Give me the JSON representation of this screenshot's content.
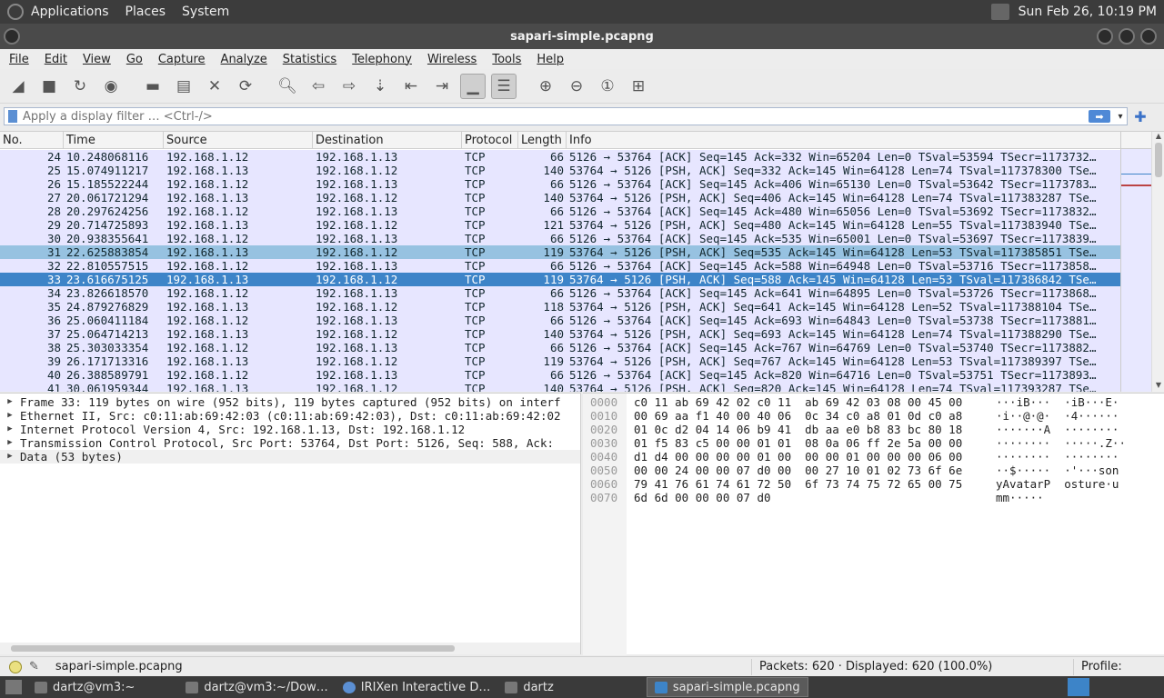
{
  "system_panel": {
    "menus": [
      "Applications",
      "Places",
      "System"
    ],
    "datetime": "Sun Feb 26, 10:19 PM"
  },
  "window": {
    "title": "sapari-simple.pcapng"
  },
  "menubar": [
    "File",
    "Edit",
    "View",
    "Go",
    "Capture",
    "Analyze",
    "Statistics",
    "Telephony",
    "Wireless",
    "Tools",
    "Help"
  ],
  "toolbar": {
    "icons": [
      "shark-fin-start-icon",
      "stop-icon",
      "restart-icon",
      "options-gear-icon",
      "open-folder-icon",
      "save-file-icon",
      "close-file-icon",
      "reload-icon",
      "search-icon",
      "go-back-icon",
      "go-forward-icon",
      "go-to-packet-icon",
      "first-packet-icon",
      "last-packet-icon",
      "autoscroll-icon",
      "colorize-icon",
      "zoom-in-icon",
      "zoom-out-icon",
      "zoom-normal-icon",
      "resize-columns-icon"
    ]
  },
  "filter": {
    "placeholder": "Apply a display filter … <Ctrl-/>"
  },
  "packet_list": {
    "columns": [
      "No.",
      "Time",
      "Source",
      "Destination",
      "Protocol",
      "Length",
      "Info"
    ],
    "rows": [
      {
        "no": "24",
        "time": "10.248068116",
        "src": "192.168.1.12",
        "dst": "192.168.1.13",
        "proto": "TCP",
        "len": "66",
        "info": "5126 → 53764 [ACK] Seq=145 Ack=332 Win=65204 Len=0 TSval=53594 TSecr=1173732…"
      },
      {
        "no": "25",
        "time": "15.074911217",
        "src": "192.168.1.13",
        "dst": "192.168.1.12",
        "proto": "TCP",
        "len": "140",
        "info": "53764 → 5126 [PSH, ACK] Seq=332 Ack=145 Win=64128 Len=74 TSval=117378300 TSe…"
      },
      {
        "no": "26",
        "time": "15.185522244",
        "src": "192.168.1.12",
        "dst": "192.168.1.13",
        "proto": "TCP",
        "len": "66",
        "info": "5126 → 53764 [ACK] Seq=145 Ack=406 Win=65130 Len=0 TSval=53642 TSecr=1173783…"
      },
      {
        "no": "27",
        "time": "20.061721294",
        "src": "192.168.1.13",
        "dst": "192.168.1.12",
        "proto": "TCP",
        "len": "140",
        "info": "53764 → 5126 [PSH, ACK] Seq=406 Ack=145 Win=64128 Len=74 TSval=117383287 TSe…"
      },
      {
        "no": "28",
        "time": "20.297624256",
        "src": "192.168.1.12",
        "dst": "192.168.1.13",
        "proto": "TCP",
        "len": "66",
        "info": "5126 → 53764 [ACK] Seq=145 Ack=480 Win=65056 Len=0 TSval=53692 TSecr=1173832…"
      },
      {
        "no": "29",
        "time": "20.714725893",
        "src": "192.168.1.13",
        "dst": "192.168.1.12",
        "proto": "TCP",
        "len": "121",
        "info": "53764 → 5126 [PSH, ACK] Seq=480 Ack=145 Win=64128 Len=55 TSval=117383940 TSe…"
      },
      {
        "no": "30",
        "time": "20.938355641",
        "src": "192.168.1.12",
        "dst": "192.168.1.13",
        "proto": "TCP",
        "len": "66",
        "info": "5126 → 53764 [ACK] Seq=145 Ack=535 Win=65001 Len=0 TSval=53697 TSecr=1173839…"
      },
      {
        "no": "31",
        "time": "22.625883854",
        "src": "192.168.1.13",
        "dst": "192.168.1.12",
        "proto": "TCP",
        "len": "119",
        "info": "53764 → 5126 [PSH, ACK] Seq=535 Ack=145 Win=64128 Len=53 TSval=117385851 TSe…",
        "state": "marked"
      },
      {
        "no": "32",
        "time": "22.810557515",
        "src": "192.168.1.12",
        "dst": "192.168.1.13",
        "proto": "TCP",
        "len": "66",
        "info": "5126 → 53764 [ACK] Seq=145 Ack=588 Win=64948 Len=0 TSval=53716 TSecr=1173858…"
      },
      {
        "no": "33",
        "time": "23.616675125",
        "src": "192.168.1.13",
        "dst": "192.168.1.12",
        "proto": "TCP",
        "len": "119",
        "info": "53764 → 5126 [PSH, ACK] Seq=588 Ack=145 Win=64128 Len=53 TSval=117386842 TSe…",
        "state": "selected"
      },
      {
        "no": "34",
        "time": "23.826618570",
        "src": "192.168.1.12",
        "dst": "192.168.1.13",
        "proto": "TCP",
        "len": "66",
        "info": "5126 → 53764 [ACK] Seq=145 Ack=641 Win=64895 Len=0 TSval=53726 TSecr=1173868…"
      },
      {
        "no": "35",
        "time": "24.879276829",
        "src": "192.168.1.13",
        "dst": "192.168.1.12",
        "proto": "TCP",
        "len": "118",
        "info": "53764 → 5126 [PSH, ACK] Seq=641 Ack=145 Win=64128 Len=52 TSval=117388104 TSe…"
      },
      {
        "no": "36",
        "time": "25.060411184",
        "src": "192.168.1.12",
        "dst": "192.168.1.13",
        "proto": "TCP",
        "len": "66",
        "info": "5126 → 53764 [ACK] Seq=145 Ack=693 Win=64843 Len=0 TSval=53738 TSecr=1173881…"
      },
      {
        "no": "37",
        "time": "25.064714213",
        "src": "192.168.1.13",
        "dst": "192.168.1.12",
        "proto": "TCP",
        "len": "140",
        "info": "53764 → 5126 [PSH, ACK] Seq=693 Ack=145 Win=64128 Len=74 TSval=117388290 TSe…"
      },
      {
        "no": "38",
        "time": "25.303033354",
        "src": "192.168.1.12",
        "dst": "192.168.1.13",
        "proto": "TCP",
        "len": "66",
        "info": "5126 → 53764 [ACK] Seq=145 Ack=767 Win=64769 Len=0 TSval=53740 TSecr=1173882…"
      },
      {
        "no": "39",
        "time": "26.171713316",
        "src": "192.168.1.13",
        "dst": "192.168.1.12",
        "proto": "TCP",
        "len": "119",
        "info": "53764 → 5126 [PSH, ACK] Seq=767 Ack=145 Win=64128 Len=53 TSval=117389397 TSe…"
      },
      {
        "no": "40",
        "time": "26.388589791",
        "src": "192.168.1.12",
        "dst": "192.168.1.13",
        "proto": "TCP",
        "len": "66",
        "info": "5126 → 53764 [ACK] Seq=145 Ack=820 Win=64716 Len=0 TSval=53751 TSecr=1173893…"
      },
      {
        "no": "41",
        "time": "30.061959344",
        "src": "192.168.1.13",
        "dst": "192.168.1.12",
        "proto": "TCP",
        "len": "140",
        "info": "53764 → 5126 [PSH, ACK] Seq=820 Ack=145 Win=64128 Len=74 TSval=117393287 TSe…"
      }
    ]
  },
  "details": [
    "Frame 33: 119 bytes on wire (952 bits), 119 bytes captured (952 bits) on interf",
    "Ethernet II, Src: c0:11:ab:69:42:03 (c0:11:ab:69:42:03), Dst: c0:11:ab:69:42:02",
    "Internet Protocol Version 4, Src: 192.168.1.13, Dst: 192.168.1.12",
    "Transmission Control Protocol, Src Port: 53764, Dst Port: 5126, Seq: 588, Ack:",
    "Data (53 bytes)"
  ],
  "bytes": {
    "offsets": [
      "0000",
      "0010",
      "0020",
      "0030",
      "0040",
      "0050",
      "0060",
      "0070"
    ],
    "hex": [
      "c0 11 ab 69 42 02 c0 11  ab 69 42 03 08 00 45 00",
      "00 69 aa f1 40 00 40 06  0c 34 c0 a8 01 0d c0 a8",
      "01 0c d2 04 14 06 b9 41  db aa e0 b8 83 bc 80 18",
      "01 f5 83 c5 00 00 01 01  08 0a 06 ff 2e 5a 00 00",
      "d1 d4 00 00 00 00 01 00  00 00 01 00 00 00 06 00",
      "00 00 24 00 00 07 d0 00  00 27 10 01 02 73 6f 6e",
      "79 41 76 61 74 61 72 50  6f 73 74 75 72 65 00 75",
      "6d 6d 00 00 00 07 d0"
    ],
    "ascii": [
      "···iB···  ·iB···E·",
      "·i··@·@·  ·4······",
      "·······A  ········",
      "········  ·····.Z··",
      "········  ········",
      "··$·····  ·'···son",
      "yAvatarP  osture·u",
      "mm·····"
    ]
  },
  "status": {
    "file": "sapari-simple.pcapng",
    "packets": "Packets: 620 · Displayed: 620 (100.0%)",
    "profile": "Profile: Default"
  },
  "taskbar": {
    "tasks": [
      "dartz@vm3:~",
      "dartz@vm3:~/Dow…",
      "IRIXen Interactive D…",
      "dartz",
      "sapari-simple.pcapng"
    ]
  }
}
